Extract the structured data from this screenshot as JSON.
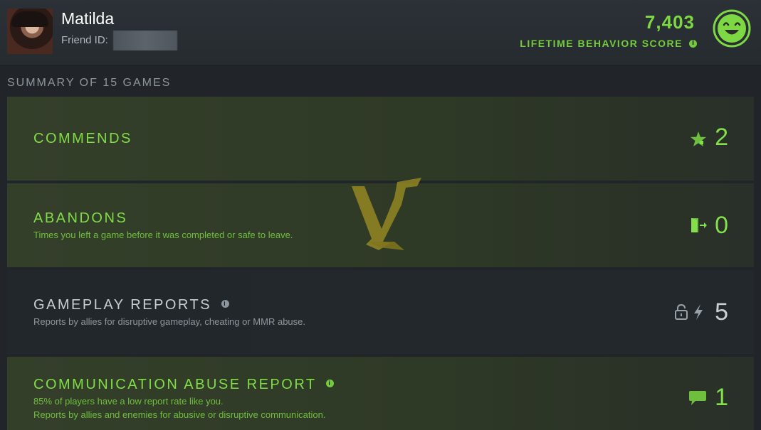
{
  "player": {
    "name": "Matilda",
    "friend_id_label": "Friend ID:"
  },
  "behavior": {
    "score": "7,403",
    "label": "LIFETIME BEHAVIOR SCORE",
    "info": "i"
  },
  "summary": {
    "title": "SUMMARY OF 15 GAMES"
  },
  "rows": [
    {
      "title": "COMMENDS",
      "description": "",
      "value": "2",
      "icon": "star-icon"
    },
    {
      "title": "ABANDONS",
      "description": "Times you left a game before it was completed or safe to leave.",
      "value": "0",
      "icon": "exit-door-icon"
    },
    {
      "title": "GAMEPLAY REPORTS",
      "info": "i",
      "description": "Reports by allies for disruptive gameplay, cheating or MMR abuse.",
      "value": "5",
      "icons": [
        "lock-icon",
        "lightning-icon"
      ]
    },
    {
      "title": "COMMUNICATION ABUSE REPORT",
      "info": "i",
      "description_line1": "85% of players have a low report rate like you.",
      "description_line2": "Reports by allies and enemies for abusive or disruptive communication.",
      "value": "1",
      "icon": "chat-bubble-icon"
    }
  ],
  "colors": {
    "accent_green": "#7fdd45",
    "neutral_text": "#c8ced3",
    "background": "#212529"
  }
}
